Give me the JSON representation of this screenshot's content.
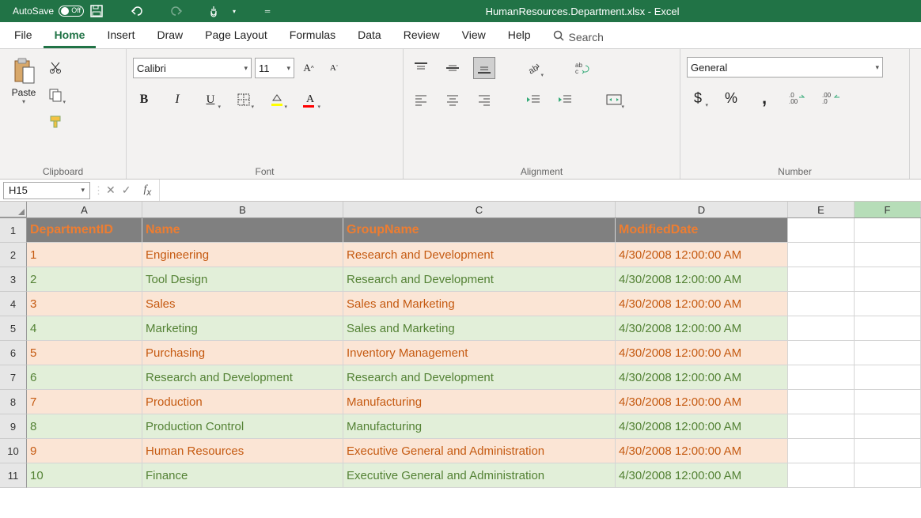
{
  "titlebar": {
    "autosave_label": "AutoSave",
    "autosave_state": "Off",
    "document_title": "HumanResources.Department.xlsx - Excel"
  },
  "tabs": {
    "file": "File",
    "home": "Home",
    "insert": "Insert",
    "draw": "Draw",
    "page_layout": "Page Layout",
    "formulas": "Formulas",
    "data": "Data",
    "review": "Review",
    "view": "View",
    "help": "Help",
    "search": "Search"
  },
  "ribbon": {
    "clipboard": {
      "paste": "Paste",
      "group": "Clipboard"
    },
    "font": {
      "name": "Calibri",
      "size": "11",
      "group": "Font"
    },
    "alignment": {
      "group": "Alignment"
    },
    "number": {
      "format": "General",
      "group": "Number"
    }
  },
  "namebox": "H15",
  "columns": [
    "A",
    "B",
    "C",
    "D",
    "E",
    "F"
  ],
  "column_widths": [
    "cw-a",
    "cw-b",
    "cw-c",
    "cw-d",
    "cw-e",
    "cw-f"
  ],
  "headers": [
    "DepartmentID",
    "Name",
    "GroupName",
    "ModifiedDate"
  ],
  "rows": [
    {
      "n": "1",
      "cells": [
        "1",
        "Engineering",
        "Research and Development",
        "4/30/2008 12:00:00 AM"
      ],
      "band": "odd"
    },
    {
      "n": "2",
      "cells": [
        "2",
        "Tool Design",
        "Research and Development",
        "4/30/2008 12:00:00 AM"
      ],
      "band": "even"
    },
    {
      "n": "3",
      "cells": [
        "3",
        "Sales",
        "Sales and Marketing",
        "4/30/2008 12:00:00 AM"
      ],
      "band": "odd"
    },
    {
      "n": "4",
      "cells": [
        "4",
        "Marketing",
        "Sales and Marketing",
        "4/30/2008 12:00:00 AM"
      ],
      "band": "even"
    },
    {
      "n": "5",
      "cells": [
        "5",
        "Purchasing",
        "Inventory Management",
        "4/30/2008 12:00:00 AM"
      ],
      "band": "odd"
    },
    {
      "n": "6",
      "cells": [
        "6",
        "Research and Development",
        "Research and Development",
        "4/30/2008 12:00:00 AM"
      ],
      "band": "even"
    },
    {
      "n": "7",
      "cells": [
        "7",
        "Production",
        "Manufacturing",
        "4/30/2008 12:00:00 AM"
      ],
      "band": "odd"
    },
    {
      "n": "8",
      "cells": [
        "8",
        "Production Control",
        "Manufacturing",
        "4/30/2008 12:00:00 AM"
      ],
      "band": "even"
    },
    {
      "n": "9",
      "cells": [
        "9",
        "Human Resources",
        "Executive General and Administration",
        "4/30/2008 12:00:00 AM"
      ],
      "band": "odd"
    },
    {
      "n": "10",
      "cells": [
        "10",
        "Finance",
        "Executive General and Administration",
        "4/30/2008 12:00:00 AM"
      ],
      "band": "even"
    }
  ]
}
